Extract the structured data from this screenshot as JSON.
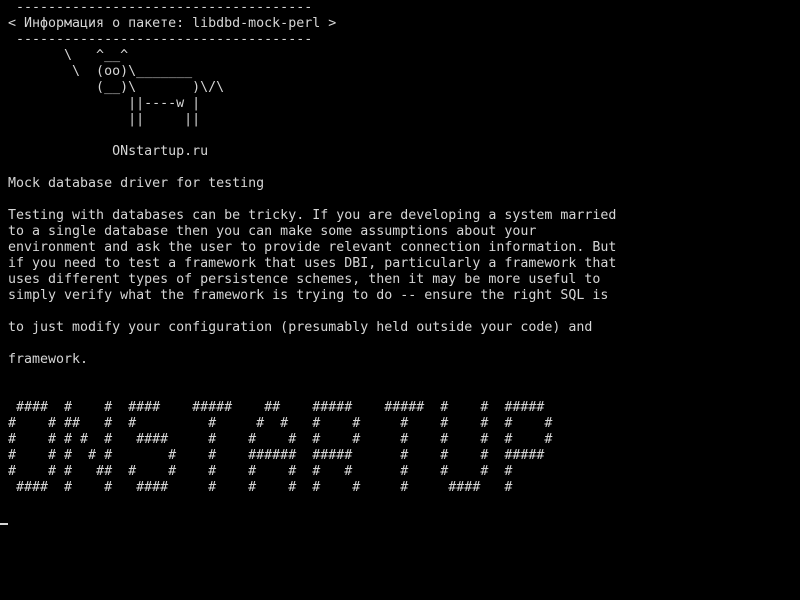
{
  "terminal": {
    "lines": [
      " -------------------------------------",
      "< Информация о пакете: libdbd-mock-perl >",
      " -------------------------------------",
      "       \\   ^__^",
      "        \\  (oo)\\_______",
      "           (__)\\       )\\/\\",
      "               ||----w |",
      "               ||     ||",
      "",
      "             ONstartup.ru",
      "",
      "Mock database driver for testing",
      "",
      "Testing with databases can be tricky. If you are developing a system married",
      "to a single database then you can make some assumptions about your",
      "environment and ask the user to provide relevant connection information. But",
      "if you need to test a framework that uses DBI, particularly a framework that",
      "uses different types of persistence schemes, then it may be more useful to",
      "simply verify what the framework is trying to do -- ensure the right SQL is",
      "",
      "to just modify your configuration (presumably held outside your code) and",
      "",
      "framework.",
      "",
      "",
      " ####  #    #  ####    #####    ##    #####    #####  #    #  #####",
      "#    # ##   #  #         #     #  #   #    #     #    #    #  #    #",
      "#    # # #  #   ####     #    #    #  #    #     #    #    #  #    #",
      "#    # #  # #       #    #    ######  #####      #    #    #  #####",
      "#    # #   ##  #    #    #    #    #  #   #      #    #    #  #",
      " ####  #    #   ####     #    #    #  #    #     #     ####   #"
    ],
    "cursor": "_"
  }
}
